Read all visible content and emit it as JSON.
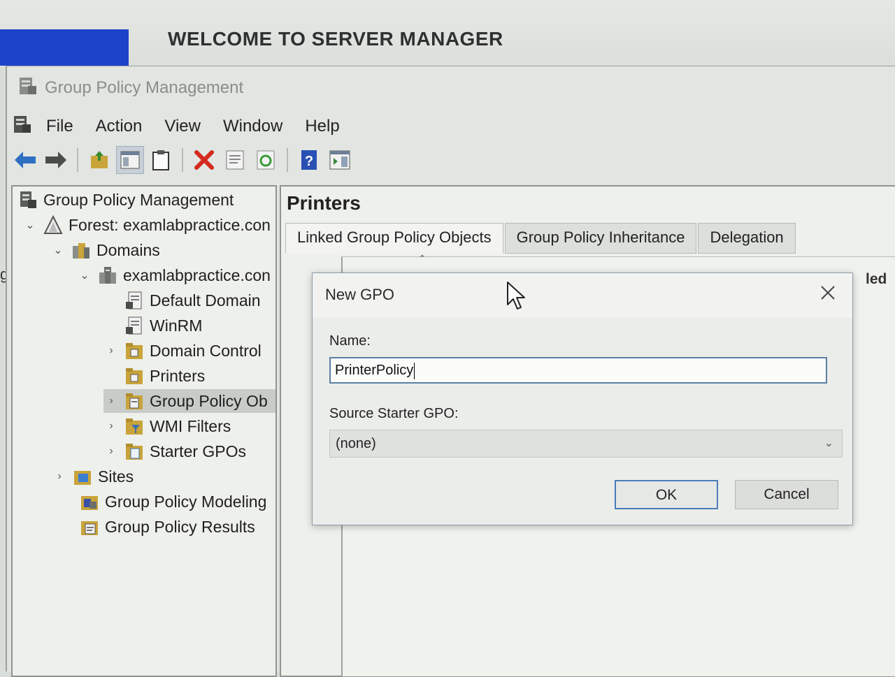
{
  "background": {
    "server_manager_title": "WELCOME TO SERVER MANAGER",
    "edge_letter": "g"
  },
  "window": {
    "title": "Group Policy Management"
  },
  "menu": [
    "File",
    "Action",
    "View",
    "Window",
    "Help"
  ],
  "toolbar": {
    "icons": [
      "back-arrow-icon",
      "forward-arrow-icon",
      "up-folder-icon",
      "show-hide-tree-icon",
      "clipboard-icon",
      "delete-icon",
      "properties-icon",
      "refresh-icon",
      "help-icon",
      "action-pane-icon"
    ]
  },
  "tree": {
    "root": "Group Policy Management",
    "forest": "Forest: examlabpractice.con",
    "domains": "Domains",
    "domain": "examlabpractice.con",
    "default_domain": "Default Domain",
    "winrm": "WinRM",
    "domain_controllers": "Domain Control",
    "printers": "Printers",
    "group_policy_objects": "Group Policy Ob",
    "wmi_filters": "WMI Filters",
    "starter_gpos": "Starter GPOs",
    "sites": "Sites",
    "modeling": "Group Policy Modeling",
    "results": "Group Policy Results"
  },
  "details": {
    "title": "Printers",
    "tabs": [
      "Linked Group Policy Objects",
      "Group Policy Inheritance",
      "Delegation"
    ],
    "partial_column": "led"
  },
  "dialog": {
    "title": "New GPO",
    "name_label": "Name:",
    "name_value": "PrinterPolicy",
    "source_label": "Source Starter GPO:",
    "source_value": "(none)",
    "ok_label": "OK",
    "cancel_label": "Cancel"
  },
  "colors": {
    "accent_blue": "#1d43c8",
    "input_border": "#5c7fa3",
    "ok_border": "#4a7cb8"
  }
}
